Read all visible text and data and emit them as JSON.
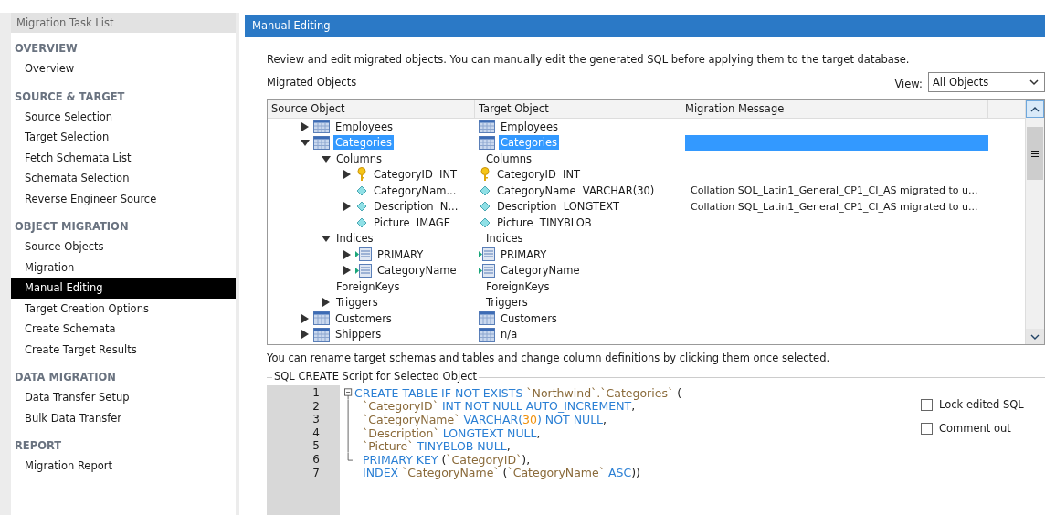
{
  "sidebar": {
    "title": "Migration Task List",
    "sections": [
      {
        "heading": "OVERVIEW",
        "items": [
          {
            "label": "Overview",
            "selected": false
          }
        ]
      },
      {
        "heading": "SOURCE & TARGET",
        "items": [
          {
            "label": "Source Selection",
            "selected": false
          },
          {
            "label": "Target Selection",
            "selected": false
          },
          {
            "label": "Fetch Schemata List",
            "selected": false
          },
          {
            "label": "Schemata Selection",
            "selected": false
          },
          {
            "label": "Reverse Engineer Source",
            "selected": false
          }
        ]
      },
      {
        "heading": "OBJECT MIGRATION",
        "items": [
          {
            "label": "Source Objects",
            "selected": false
          },
          {
            "label": "Migration",
            "selected": false
          },
          {
            "label": "Manual Editing",
            "selected": true
          },
          {
            "label": "Target Creation Options",
            "selected": false
          },
          {
            "label": "Create Schemata",
            "selected": false
          },
          {
            "label": "Create Target Results",
            "selected": false
          }
        ]
      },
      {
        "heading": "DATA MIGRATION",
        "items": [
          {
            "label": "Data Transfer Setup",
            "selected": false
          },
          {
            "label": "Bulk Data Transfer",
            "selected": false
          }
        ]
      },
      {
        "heading": "REPORT",
        "items": [
          {
            "label": "Migration Report",
            "selected": false
          }
        ]
      }
    ]
  },
  "page": {
    "title": "Manual Editing",
    "description": "Review and edit migrated objects. You can manually edit the generated SQL before applying them to the target database.",
    "objects_label": "Migrated Objects",
    "view_label": "View:",
    "view_value": "All Objects"
  },
  "tree": {
    "columns": [
      "Source Object",
      "Target Object",
      "Migration Message"
    ],
    "rows": [
      {
        "kind": "table",
        "source": "Employees",
        "target": "Employees",
        "expandable": true,
        "expanded": false,
        "selected": false
      },
      {
        "kind": "table",
        "source": "Categories",
        "target": "Categories",
        "expandable": true,
        "expanded": true,
        "selected": true,
        "children": [
          {
            "kind": "group",
            "source": "Columns",
            "target": "Columns",
            "expandable": true,
            "expanded": true,
            "selected": false,
            "children": [
              {
                "kind": "key",
                "source": "CategoryID  INT",
                "target": "CategoryID  INT",
                "expandable": true,
                "expanded": false,
                "selected": false
              },
              {
                "kind": "column",
                "source": "CategoryNam...",
                "target": "CategoryName  VARCHAR(30)",
                "message": "Collation SQL_Latin1_General_CP1_CI_AS migrated to u...",
                "expandable": false,
                "selected": false
              },
              {
                "kind": "column",
                "source": "Description  N...",
                "target": "Description  LONGTEXT",
                "message": "Collation SQL_Latin1_General_CP1_CI_AS migrated to u...",
                "expandable": true,
                "expanded": false,
                "selected": false
              },
              {
                "kind": "column",
                "source": "Picture  IMAGE",
                "target": "Picture  TINYBLOB",
                "expandable": false,
                "selected": false
              }
            ]
          },
          {
            "kind": "group",
            "source": "Indices",
            "target": "Indices",
            "expandable": true,
            "expanded": true,
            "selected": false,
            "children": [
              {
                "kind": "index",
                "source": "PRIMARY",
                "target": "PRIMARY",
                "expandable": true,
                "expanded": false,
                "selected": false
              },
              {
                "kind": "index",
                "source": "CategoryName",
                "target": "CategoryName",
                "expandable": true,
                "expanded": false,
                "selected": false
              }
            ]
          },
          {
            "kind": "group",
            "source": "ForeignKeys",
            "target": "ForeignKeys",
            "expandable": false,
            "selected": false
          },
          {
            "kind": "group",
            "source": "Triggers",
            "target": "Triggers",
            "expandable": true,
            "expanded": false,
            "selected": false
          }
        ]
      },
      {
        "kind": "table",
        "source": "Customers",
        "target": "Customers",
        "expandable": true,
        "expanded": false,
        "selected": false
      },
      {
        "kind": "table",
        "source": "Shippers",
        "target": "n/a",
        "expandable": true,
        "expanded": false,
        "selected": false
      }
    ]
  },
  "hint": "You can rename target schemas and tables and change column definitions by clicking them once selected.",
  "script": {
    "title": "SQL CREATE Script for Selected Object",
    "lines": [
      {
        "number": "1",
        "kind": "fold-start",
        "tokens": [
          {
            "kind": "keyword",
            "text": "CREATE TABLE IF NOT EXISTS "
          },
          {
            "kind": "identifier",
            "text": "`Northwind`.`Categories`"
          },
          {
            "kind": "punct",
            "text": " ("
          }
        ]
      },
      {
        "number": "2",
        "kind": "fold-body",
        "tokens": [
          {
            "kind": "identifier",
            "text": "`CategoryID`"
          },
          {
            "kind": "keyword",
            "text": " INT NOT NULL AUTO_INCREMENT"
          },
          {
            "kind": "punct",
            "text": ","
          }
        ]
      },
      {
        "number": "3",
        "kind": "fold-body",
        "tokens": [
          {
            "kind": "identifier",
            "text": "`CategoryName`"
          },
          {
            "kind": "keyword",
            "text": " VARCHAR("
          },
          {
            "kind": "number",
            "text": "30"
          },
          {
            "kind": "keyword",
            "text": ") NOT NULL"
          },
          {
            "kind": "punct",
            "text": ","
          }
        ]
      },
      {
        "number": "4",
        "kind": "fold-body",
        "tokens": [
          {
            "kind": "identifier",
            "text": "`Description`"
          },
          {
            "kind": "keyword",
            "text": " LONGTEXT NULL"
          },
          {
            "kind": "punct",
            "text": ","
          }
        ]
      },
      {
        "number": "5",
        "kind": "fold-body",
        "tokens": [
          {
            "kind": "identifier",
            "text": "`Picture`"
          },
          {
            "kind": "keyword",
            "text": " TINYBLOB NULL"
          },
          {
            "kind": "punct",
            "text": ","
          }
        ]
      },
      {
        "number": "6",
        "kind": "fold-end",
        "tokens": [
          {
            "kind": "keyword",
            "text": "PRIMARY KEY"
          },
          {
            "kind": "punct",
            "text": " ("
          },
          {
            "kind": "identifier",
            "text": "`CategoryID`"
          },
          {
            "kind": "punct",
            "text": "),"
          }
        ]
      },
      {
        "number": "7",
        "kind": "plain",
        "tokens": [
          {
            "kind": "keyword",
            "text": "INDEX "
          },
          {
            "kind": "identifier",
            "text": "`CategoryName`"
          },
          {
            "kind": "punct",
            "text": " ("
          },
          {
            "kind": "identifier",
            "text": "`CategoryName`"
          },
          {
            "kind": "keyword",
            "text": " ASC"
          },
          {
            "kind": "punct",
            "text": "))"
          }
        ]
      }
    ]
  },
  "options": [
    {
      "label": "Lock edited SQL",
      "checked": false
    },
    {
      "label": "Comment out",
      "checked": false
    }
  ]
}
